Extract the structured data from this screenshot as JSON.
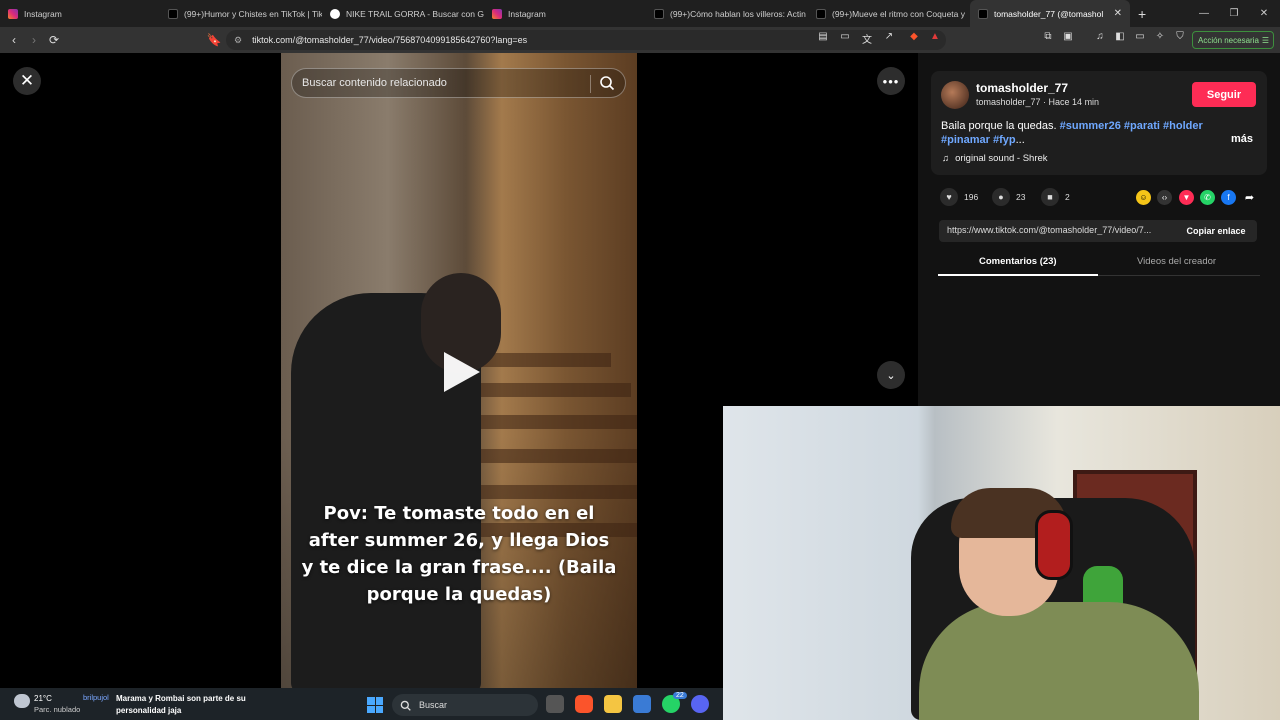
{
  "browser": {
    "tabs": [
      {
        "title": "Instagram",
        "icon": "instagram-icon"
      },
      {
        "title": "(99+)Humor y Chistes en TikTok | Tik",
        "icon": "tiktok-icon"
      },
      {
        "title": "NIKE TRAIL GORRA - Buscar con Goo",
        "icon": "google-icon"
      },
      {
        "title": "Instagram",
        "icon": "instagram-icon"
      },
      {
        "title": "(99+)Cómo hablan los villeros: Actin",
        "icon": "tiktok-icon"
      },
      {
        "title": "(99+)Mueve el ritmo con Coqueta y",
        "icon": "tiktok-icon"
      },
      {
        "title": "tomasholder_77 (@tomashol",
        "icon": "tiktok-icon",
        "active": true
      }
    ],
    "url": "tiktok.com/@tomasholder_77/video/7568704099185642760?lang=es",
    "action_button": "Acción necesaria"
  },
  "video": {
    "search_placeholder": "Buscar contenido relacionado",
    "caption": "Pov: Te tomaste todo en el after summer 26, y llega Dios y te dice la gran frase.... (Baila porque la quedas)"
  },
  "post": {
    "username": "tomasholder_77",
    "subline": "tomasholder_77 · Hace 14 min",
    "follow_label": "Seguir",
    "description_text": "Baila porque la quedas.",
    "hashtags": [
      "#summer26",
      "#parati",
      "#holder",
      "#pinamar",
      "#fyp"
    ],
    "more_label": "más",
    "sound": "original sound - Shrek",
    "likes": "196",
    "comments": "23",
    "saves": "2",
    "link": "https://www.tiktok.com/@tomasholder_77/video/7...",
    "copy_label": "Copiar enlace",
    "tab_comments": "Comentarios (23)",
    "tab_creator": "Videos del creador"
  },
  "taskbar": {
    "temperature": "21°C",
    "weather": "Parc. nublado",
    "news_user": "brilpujol",
    "news_text": "Marama y Rombai son parte de su personalidad jaja",
    "search_label": "Buscar",
    "whatsapp_badge": "22"
  },
  "colors": {
    "accent": "#fe2c55",
    "hashtag": "#6fa8ff",
    "background": "#121212"
  }
}
